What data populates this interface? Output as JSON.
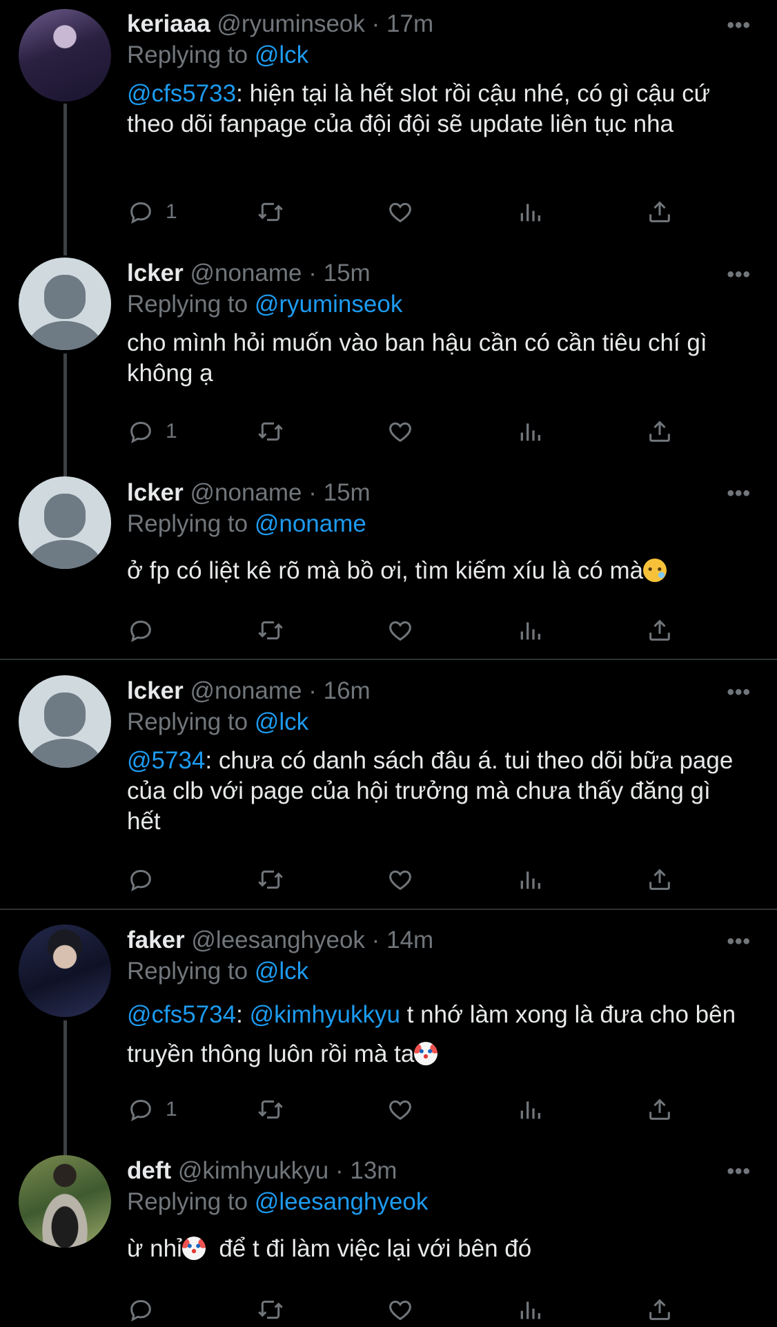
{
  "tweets": [
    {
      "name": "keriaaa",
      "handle": "@ryuminseok",
      "sep": "·",
      "time": "17m",
      "replying_label": "Replying to",
      "replying_to": "@lck",
      "mention": "@cfs5733",
      "text": ": hiện tại là hết slot rồi cậu nhé, có gì cậu cứ theo dõi fanpage của đội đội sẽ update liên tục nha",
      "reply_count": "1"
    },
    {
      "name": "lcker",
      "handle": "@noname",
      "sep": "·",
      "time": "15m",
      "replying_label": "Replying to",
      "replying_to": "@ryuminseok",
      "text": "cho mình hỏi muốn vào ban hậu cần có cần tiêu chí gì không ạ",
      "reply_count": "1"
    },
    {
      "name": "lcker",
      "handle": "@noname",
      "sep": "·",
      "time": "15m",
      "replying_label": "Replying to",
      "replying_to": "@noname",
      "text": "ở fp có liệt kê rõ mà bồ ơi, tìm kiếm xíu là có mà",
      "reply_count": ""
    },
    {
      "name": "lcker",
      "handle": "@noname",
      "sep": "·",
      "time": "16m",
      "replying_label": "Replying to",
      "replying_to": "@lck",
      "mention": "@5734",
      "text": ": chưa có danh sách đâu á. tui theo dõi bữa page của clb với page của hội trưởng mà chưa thấy đăng gì hết",
      "reply_count": ""
    },
    {
      "name": "faker",
      "handle": "@leesanghyeok",
      "sep": "·",
      "time": "14m",
      "replying_label": "Replying to",
      "replying_to": "@lck",
      "mention": "@cfs5734",
      "sep2": ": ",
      "mention2": "@kimhyukkyu",
      "text": " t nhớ làm xong là đưa cho bên truyền thông luôn rồi mà ta",
      "reply_count": "1"
    },
    {
      "name": "deft",
      "handle": "@kimhyukkyu",
      "sep": "·",
      "time": "13m",
      "replying_label": "Replying to",
      "replying_to": "@leesanghyeok",
      "text_a": "ừ nhỉ",
      "text_b": "  để t đi làm việc lại với bên đó",
      "reply_count": ""
    }
  ],
  "colors": {
    "link": "#1d9bf0",
    "muted": "#71767b",
    "text": "#e7e9ea",
    "background": "#000000"
  },
  "icons": [
    "reply-icon",
    "retweet-icon",
    "like-icon",
    "views-icon",
    "share-icon",
    "more-icon"
  ]
}
